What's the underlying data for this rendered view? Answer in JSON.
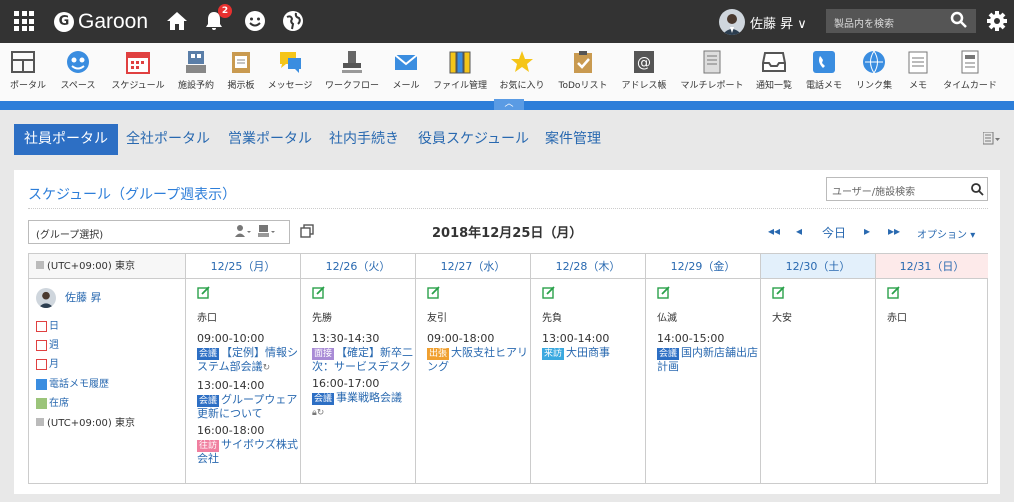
{
  "topbar": {
    "app_name": "Garoon",
    "notification_count": "2",
    "user_name": "佐藤 昇",
    "search_placeholder": "製品内を検索"
  },
  "apps": [
    {
      "label": "ポータル",
      "icon": "portal-icon"
    },
    {
      "label": "スペース",
      "icon": "space-icon"
    },
    {
      "label": "スケジュール",
      "icon": "schedule-icon"
    },
    {
      "label": "施設予約",
      "icon": "facility-icon"
    },
    {
      "label": "掲示板",
      "icon": "bulletin-icon"
    },
    {
      "label": "メッセージ",
      "icon": "message-icon"
    },
    {
      "label": "ワークフロー",
      "icon": "workflow-icon"
    },
    {
      "label": "メール",
      "icon": "mail-icon"
    },
    {
      "label": "ファイル管理",
      "icon": "file-icon"
    },
    {
      "label": "お気に入り",
      "icon": "star-icon"
    },
    {
      "label": "ToDoリスト",
      "icon": "todo-icon"
    },
    {
      "label": "アドレス帳",
      "icon": "address-icon"
    },
    {
      "label": "マルチレポート",
      "icon": "report-icon"
    },
    {
      "label": "通知一覧",
      "icon": "inbox-icon"
    },
    {
      "label": "電話メモ",
      "icon": "phone-icon"
    },
    {
      "label": "リンク集",
      "icon": "link-icon"
    },
    {
      "label": "メモ",
      "icon": "memo-icon"
    },
    {
      "label": "タイムカード",
      "icon": "timecard-icon"
    }
  ],
  "tabs": [
    "社員ポータル",
    "全社ポータル",
    "営業ポータル",
    "社内手続き",
    "役員スケジュール",
    "案件管理"
  ],
  "schedule": {
    "title": "スケジュール（グループ週表示）",
    "user_search_placeholder": "ユーザー/施設検索",
    "group_select": "(グループ選択)",
    "date_title": "2018年12月25日（月）",
    "today_label": "今日",
    "options_label": "オプション",
    "timezone": "(UTC+09:00) 東京",
    "days": [
      {
        "label": "12/25（月）",
        "rokuyo": "赤口"
      },
      {
        "label": "12/26（火）",
        "rokuyo": "先勝"
      },
      {
        "label": "12/27（水）",
        "rokuyo": "友引"
      },
      {
        "label": "12/28（木）",
        "rokuyo": "先負"
      },
      {
        "label": "12/29（金）",
        "rokuyo": "仏滅"
      },
      {
        "label": "12/30（土）",
        "rokuyo": "大安"
      },
      {
        "label": "12/31（日）",
        "rokuyo": "赤口"
      }
    ],
    "user": {
      "name": "佐藤 昇",
      "links": [
        "日",
        "週",
        "月",
        "電話メモ履歴",
        "在席"
      ],
      "timezone": "(UTC+09:00) 東京"
    },
    "events": {
      "d0": [
        {
          "time": "09:00-10:00",
          "tag": "会議",
          "tag_color": "#2d6fc4",
          "text": "【定例】情報システム部会議"
        },
        {
          "time": "13:00-14:00",
          "tag": "会議",
          "tag_color": "#2d6fc4",
          "text": "グループウェア更新について"
        },
        {
          "time": "16:00-18:00",
          "tag": "往訪",
          "tag_color": "#f07fa0",
          "text": "サイボウズ株式会社"
        }
      ],
      "d1": [
        {
          "time": "13:30-14:30",
          "tag": "面接",
          "tag_color": "#a98bd6",
          "text": "【確定】新卒二次：サービスデスク"
        },
        {
          "time": "16:00-17:00",
          "tag": "会議",
          "tag_color": "#2d6fc4",
          "text": "事業戦略会議"
        }
      ],
      "d2": [
        {
          "time": "09:00-18:00",
          "tag": "出張",
          "tag_color": "#f0a030",
          "text": "大阪支社ヒアリング"
        }
      ],
      "d3": [
        {
          "time": "13:00-14:00",
          "tag": "来訪",
          "tag_color": "#3aa9e0",
          "text": "大田商事"
        }
      ],
      "d4": [
        {
          "time": "14:00-15:00",
          "tag": "会議",
          "tag_color": "#2d6fc4",
          "text": "国内新店舗出店計画"
        }
      ]
    }
  }
}
